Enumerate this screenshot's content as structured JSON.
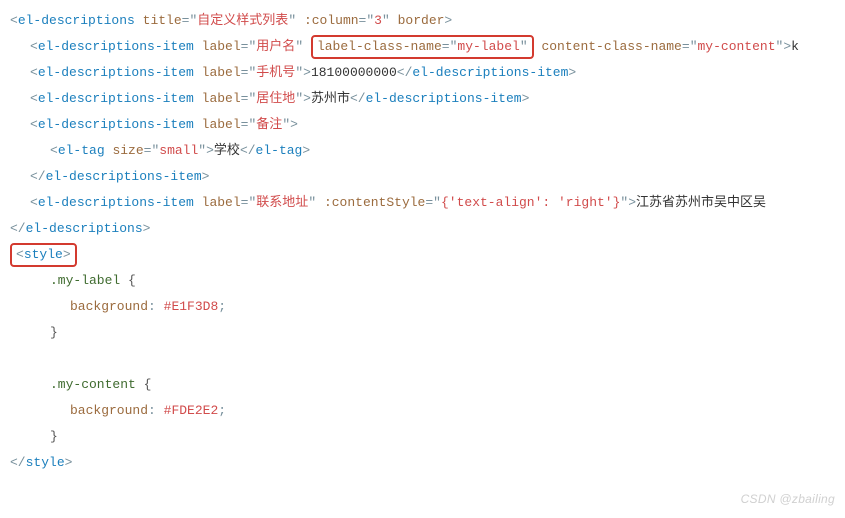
{
  "lines": {
    "l1": {
      "tag": "el-descriptions",
      "attr1_name": "title",
      "attr1_val": "自定义样式列表",
      "attr2_name": ":column",
      "attr2_val": "3",
      "attr3_name": "border"
    },
    "l2": {
      "tag": "el-descriptions-item",
      "a1n": "label",
      "a1v": "用户名",
      "hl_attr_n": "label-class-name",
      "hl_attr_v": "my-label",
      "a3n": "content-class-name",
      "a3v": "my-content",
      "trail_text": "k"
    },
    "l3": {
      "tag": "el-descriptions-item",
      "a1n": "label",
      "a1v": "手机号",
      "text": "18100000000",
      "close": "el-descriptions-item"
    },
    "l4": {
      "tag": "el-descriptions-item",
      "a1n": "label",
      "a1v": "居住地",
      "text": "苏州市",
      "close": "el-descriptions-item"
    },
    "l5": {
      "tag": "el-descriptions-item",
      "a1n": "label",
      "a1v": "备注"
    },
    "l6": {
      "tag": "el-tag",
      "a1n": "size",
      "a1v": "small",
      "text": "学校",
      "close": "el-tag"
    },
    "l7": {
      "close": "el-descriptions-item"
    },
    "l8": {
      "tag": "el-descriptions-item",
      "a1n": "label",
      "a1v": "联系地址",
      "a2n": ":contentStyle",
      "a2v": "{'text-align': 'right'}",
      "text": "江苏省苏州市吴中区吴"
    },
    "l9": {
      "close": "el-descriptions"
    },
    "l10_tag": "style",
    "css": {
      "sel1": ".my-label",
      "prop1": "background",
      "val1": "#E1F3D8",
      "sel2": ".my-content",
      "prop2": "background",
      "val2": "#FDE2E2"
    },
    "style_close": "style"
  },
  "watermark": "CSDN @zbailing"
}
